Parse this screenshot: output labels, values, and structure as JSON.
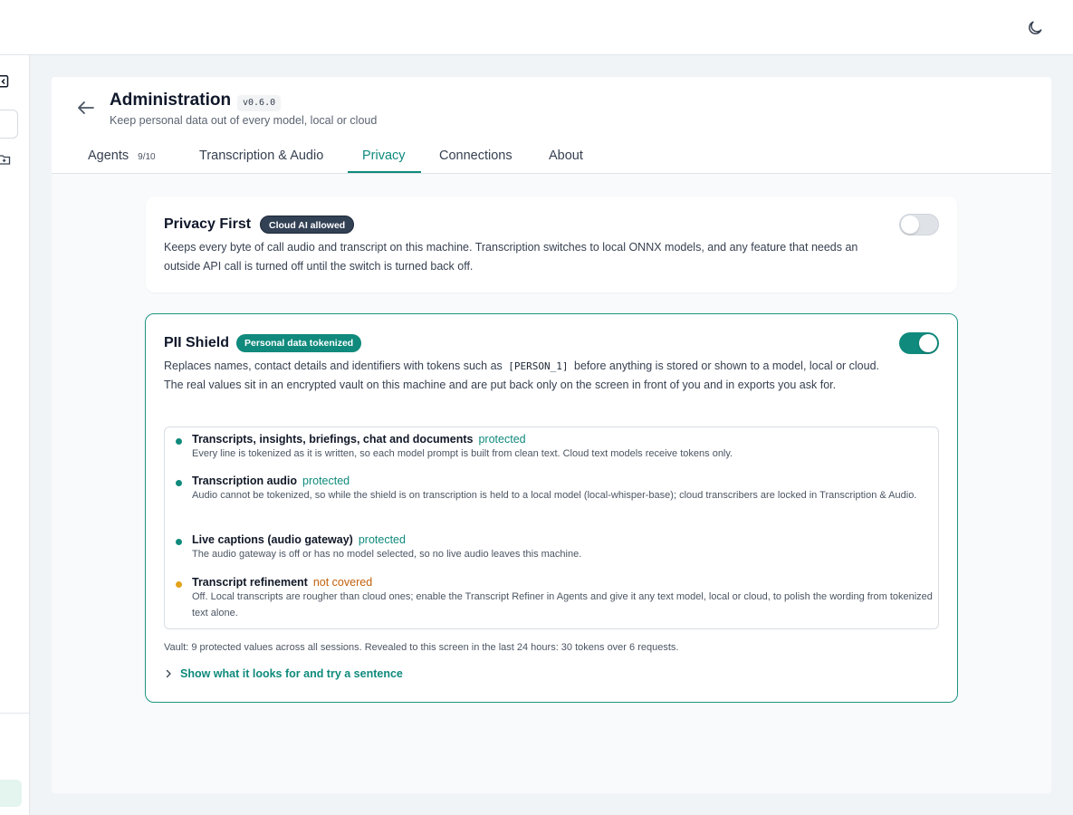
{
  "header": {
    "title": "Administration",
    "version": "v0.6.0",
    "subtitle": "Keep personal data out of every model, local or cloud"
  },
  "tabs": [
    {
      "label": "Agents",
      "count": "9/10"
    },
    {
      "label": "Transcription & Audio"
    },
    {
      "label": "Privacy",
      "active": true
    },
    {
      "label": "Connections"
    },
    {
      "label": "About"
    }
  ],
  "privacy_first": {
    "title": "Privacy First",
    "badge": "Cloud AI allowed",
    "description": "Keeps every byte of call audio and transcript on this machine. Transcription switches to local ONNX models, and any feature that needs an outside API call is turned off until the switch is turned back off.",
    "enabled": false
  },
  "pii_shield": {
    "title": "PII Shield",
    "badge": "Personal data tokenized",
    "desc_before": "Replaces names, contact details and identifiers with tokens such as",
    "token_example": "[PERSON_1]",
    "desc_after": "before anything is stored or shown to a model, local or cloud. The real values sit in an encrypted vault on this machine and are put back only on the screen in front of you and in exports you ask for.",
    "enabled": true,
    "items": [
      {
        "title": "Transcripts, insights, briefings, chat and documents",
        "status": "protected",
        "desc": "Every line is tokenized as it is written, so each model prompt is built from clean text. Cloud text models receive tokens only."
      },
      {
        "title": "Transcription audio",
        "status": "protected",
        "desc": "Audio cannot be tokenized, so while the shield is on transcription is held to a local model (local-whisper-base); cloud transcribers are locked in Transcription & Audio."
      },
      {
        "title": "Live captions (audio gateway)",
        "status": "protected",
        "desc": "The audio gateway is off or has no model selected, so no live audio leaves this machine."
      },
      {
        "title": "Transcript refinement",
        "status": "not covered",
        "desc": "Off. Local transcripts are rougher than cloud ones; enable the Transcript Refiner in Agents and give it any text model, local or cloud, to polish the wording from tokenized text alone."
      }
    ],
    "vault_summary": "Vault: 9 protected values across all sessions. Revealed to this screen in the last 24 hours: 30 tokens over 6 requests.",
    "disclosure_label": "Show what it looks for and try a sentence"
  },
  "colors": {
    "accent": "#0f8a7c",
    "protected_dot": "#0f8a7c",
    "not_covered_dot": "#e3a21a",
    "dark_badge": "#334155"
  }
}
